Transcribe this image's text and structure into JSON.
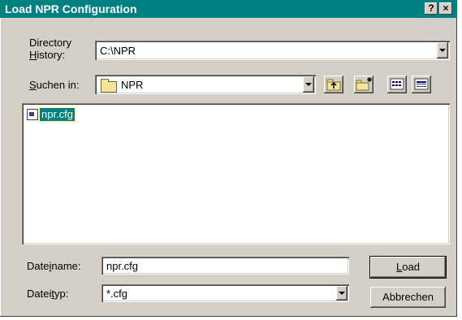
{
  "window": {
    "title": "Load NPR Configuration",
    "help_label": "?",
    "close_label": "×"
  },
  "directory_history": {
    "label_line1": "Directory",
    "label_line2_ul": "H",
    "label_line2_rest": "istory:",
    "value": "C:\\NPR"
  },
  "look_in": {
    "label_ul": "S",
    "label_rest": "uchen in:",
    "value": "NPR"
  },
  "file_list": {
    "items": [
      {
        "name": "npr.cfg",
        "selected": true
      }
    ]
  },
  "filename": {
    "label_pre": "Date",
    "label_ul": "i",
    "label_post": "name:",
    "value": "npr.cfg"
  },
  "filetype": {
    "label_pre": "Datei",
    "label_ul": "t",
    "label_post": "yp:",
    "value": "*.cfg"
  },
  "buttons": {
    "load_ul": "L",
    "load_rest": "oad",
    "cancel": "Abbrechen"
  },
  "colors": {
    "titlebar": "#008080",
    "face": "#d4d0c8",
    "selection": "#008080"
  }
}
